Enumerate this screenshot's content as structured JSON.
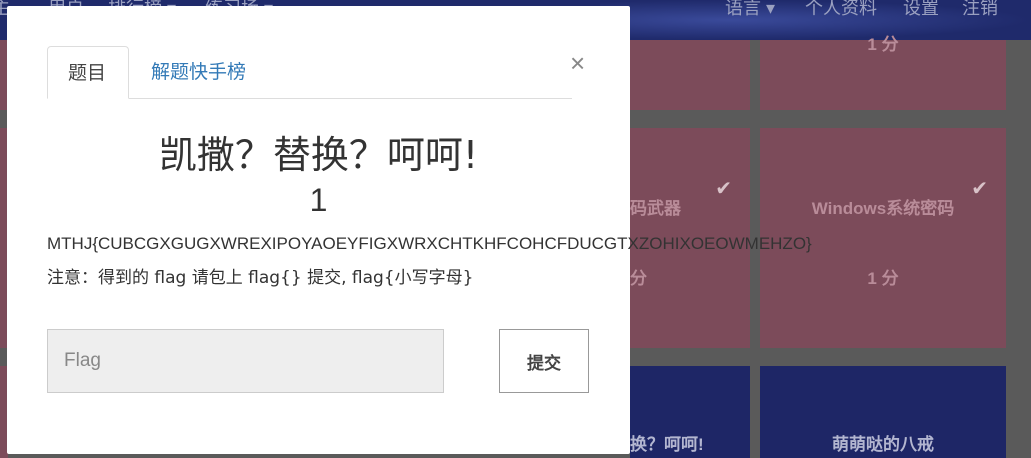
{
  "background": {
    "nav_left": [
      "主",
      "用户",
      "排行榜 ▾",
      "练习场 ▾"
    ],
    "nav_right": [
      "语言 ▾",
      "个人资料",
      "设置",
      "注销"
    ],
    "cards": [
      {
        "title": "",
        "points": "1 分"
      },
      {
        "title": "码武器",
        "points": "分"
      },
      {
        "title": "Windows系统密码",
        "points": "1 分"
      },
      {
        "title": "换？呵呵!",
        "points": ""
      },
      {
        "title": "萌萌哒的八戒",
        "points": ""
      }
    ]
  },
  "modal": {
    "tabs": [
      {
        "label": "题目"
      },
      {
        "label": "解题快手榜"
      }
    ],
    "close_glyph": "×",
    "challenge": {
      "title": "凯撒？替换？呵呵!",
      "points": "1",
      "ciphertext": "MTHJ{CUBCGXGUGXWREXIPOYAOEYFIGXWRXCHTKHFCOHCFDUCGTXZOHIXOEOWMEHZO}",
      "note": "注意：得到的 flag 请包上 flag{} 提交, flag{小写字母}"
    },
    "flag_input": {
      "placeholder": "Flag",
      "value": ""
    },
    "submit_label": "提交"
  }
}
